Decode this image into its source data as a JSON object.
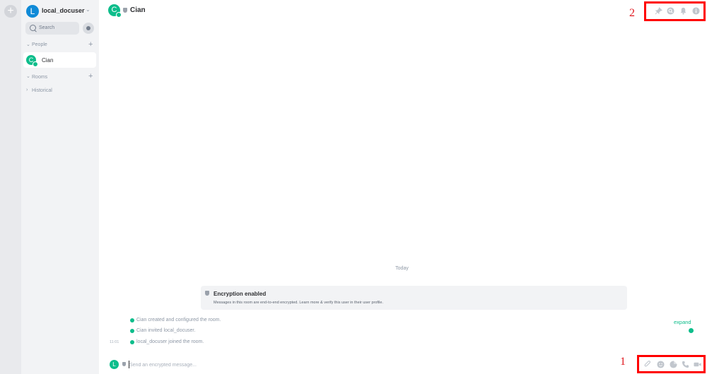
{
  "space_bar": {
    "add_label": "+"
  },
  "user_menu": {
    "avatar_letter": "L",
    "name": "local_docuser",
    "chevron": "⌄"
  },
  "search": {
    "label": "Search"
  },
  "sections": {
    "people": {
      "label": "People",
      "chevron": "⌄",
      "add": "+"
    },
    "rooms": {
      "label": "Rooms",
      "chevron": "⌄",
      "add": "+"
    },
    "historical": {
      "label": "Historical",
      "chevron": "›"
    }
  },
  "room_list": [
    {
      "name": "Cian",
      "avatar_letter": "C"
    }
  ],
  "header": {
    "avatar_letter": "C",
    "title": "Cian"
  },
  "annotations": {
    "header_label": "2",
    "composer_label": "1"
  },
  "timeline": {
    "date_separator": "Today",
    "encryption_title": "Encryption enabled",
    "encryption_desc": "Messages in this room are end-to-end encrypted. Learn more & verify this user in their user profile.",
    "events": [
      "Cian created and configured the room.",
      "Cian invited local_docuser.",
      "local_docuser joined the room."
    ],
    "expand_label": "expand",
    "timestamp": "11:01"
  },
  "composer": {
    "avatar_letter": "L",
    "placeholder": "Send an encrypted message..."
  },
  "colors": {
    "accent": "#0dbd8b",
    "user_avatar": "#0f8ad7",
    "annotation": "#ff0000"
  },
  "icons": {
    "header": [
      "pin-icon",
      "search-icon",
      "bell-icon",
      "info-icon"
    ],
    "composer": [
      "paperclip-icon",
      "emoji-icon",
      "sticker-icon",
      "phone-icon",
      "video-icon"
    ]
  }
}
